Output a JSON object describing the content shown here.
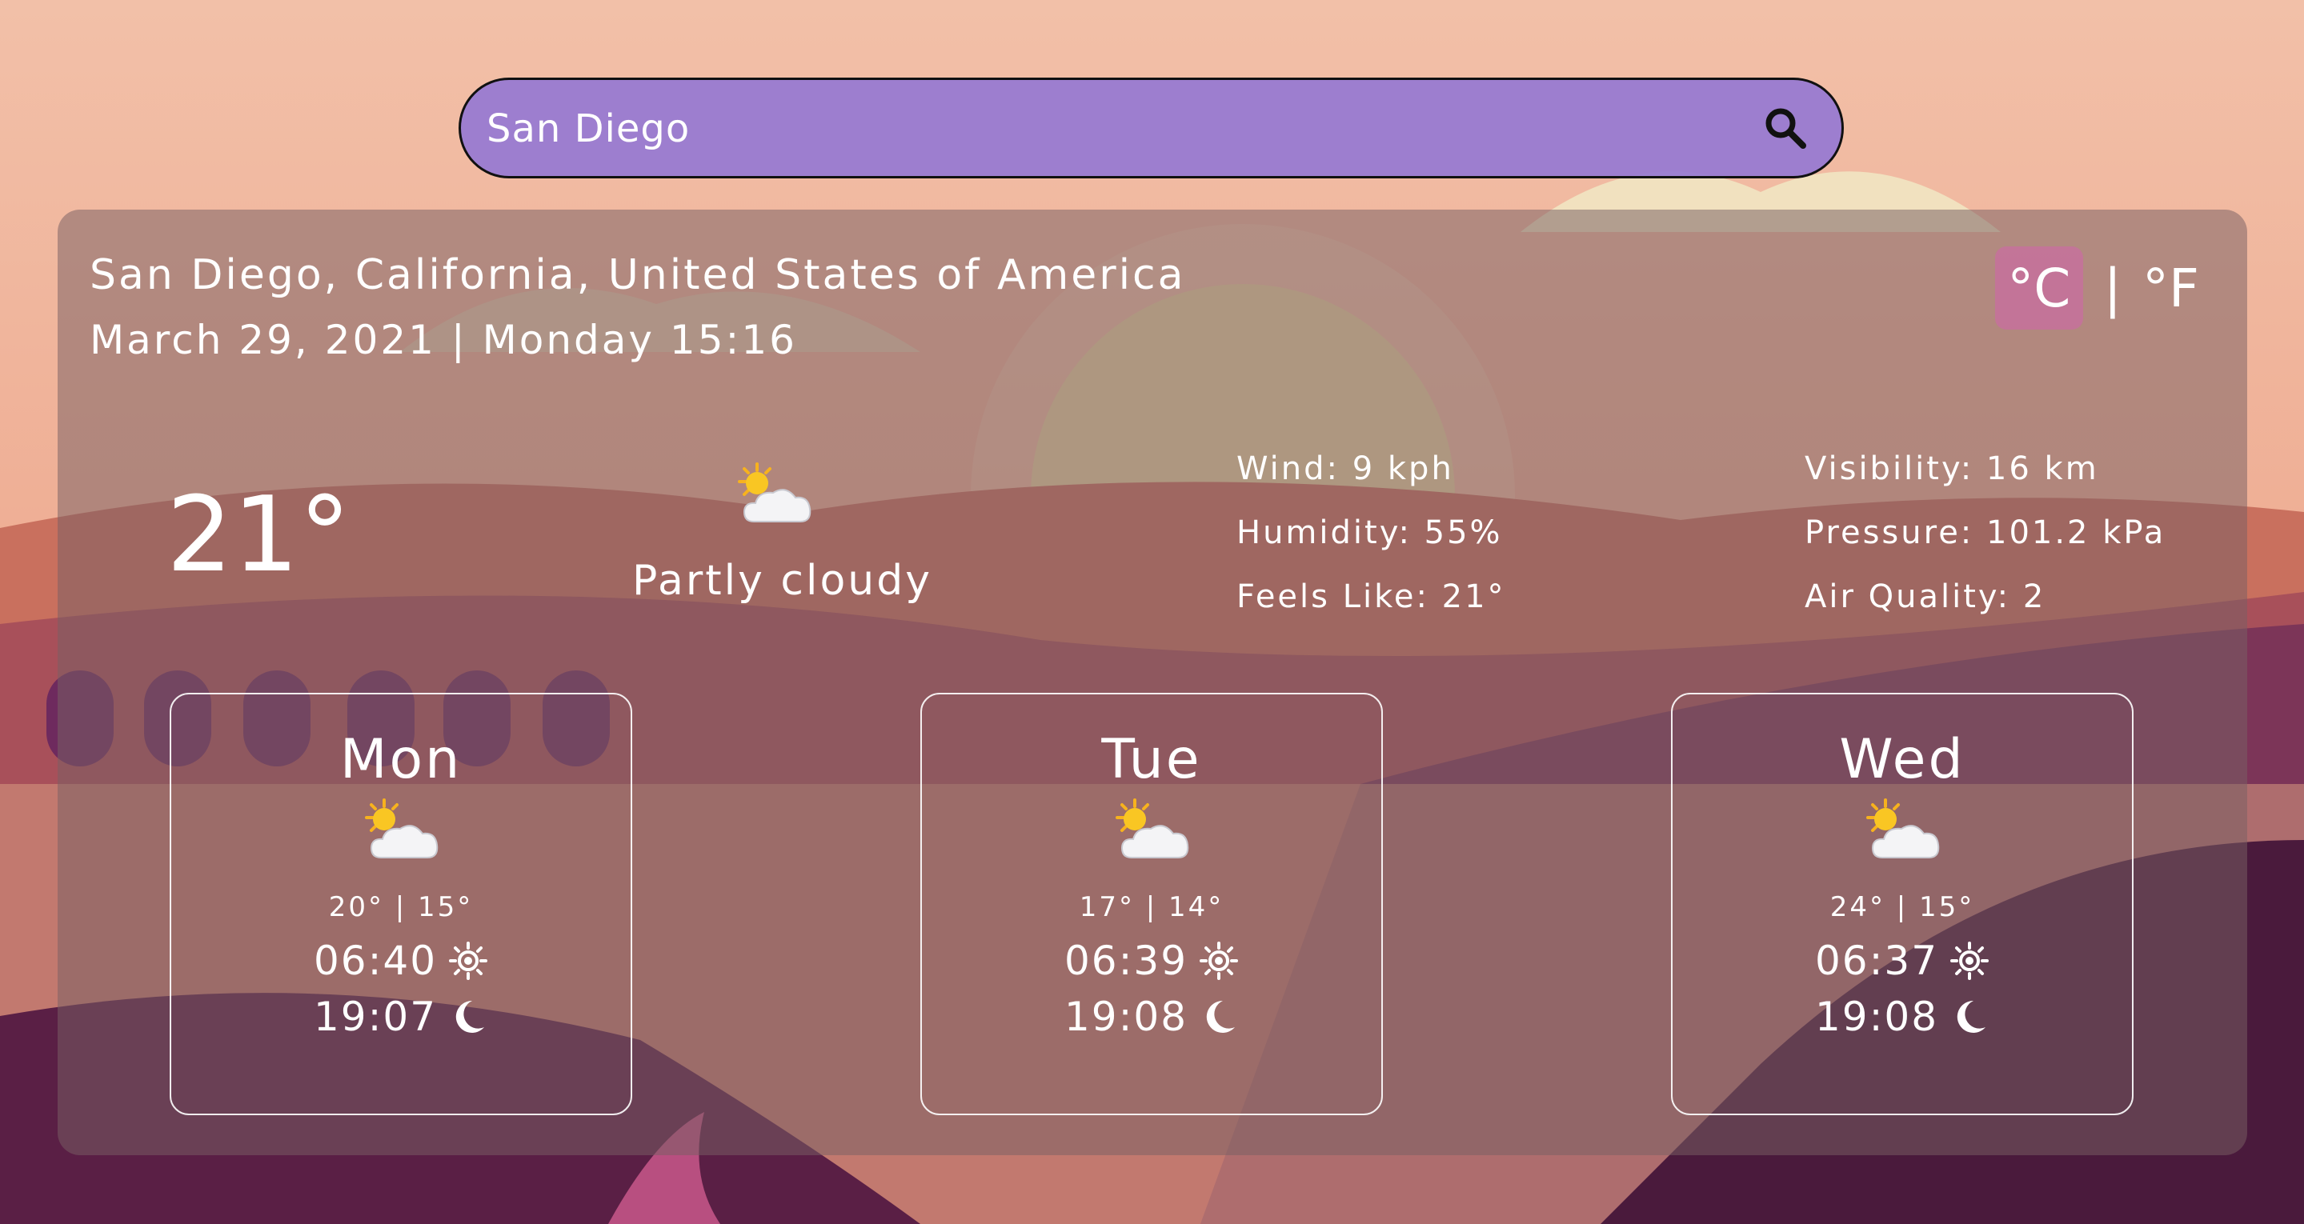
{
  "search": {
    "value": "San Diego"
  },
  "location": {
    "name": "San Diego, California, United States of America",
    "datetime": "March 29, 2021 | Monday 15:16"
  },
  "units": {
    "celsius": "°C",
    "separator": "|",
    "fahrenheit": "°F"
  },
  "current": {
    "temperature": "21°",
    "condition": "Partly cloudy",
    "icon": "partly-cloudy-icon",
    "wind": "Wind: 9 kph",
    "humidity": "Humidity: 55%",
    "feels_like": "Feels Like: 21°",
    "visibility": "Visibility: 16 km",
    "pressure": "Pressure: 101.2 kPa",
    "air_quality": "Air Quality: 2"
  },
  "forecast": [
    {
      "day": "Mon",
      "temps": "20° | 15°",
      "sunrise": "06:40",
      "sunset": "19:07",
      "icon": "partly-cloudy-icon"
    },
    {
      "day": "Tue",
      "temps": "17° | 14°",
      "sunrise": "06:39",
      "sunset": "19:08",
      "icon": "partly-cloudy-icon"
    },
    {
      "day": "Wed",
      "temps": "24° | 15°",
      "sunrise": "06:37",
      "sunset": "19:08",
      "icon": "partly-cloudy-icon"
    }
  ],
  "colors": {
    "search_bg": "#9b7fcf",
    "unit_active": "#c86ea0",
    "panel": "#785f64"
  }
}
